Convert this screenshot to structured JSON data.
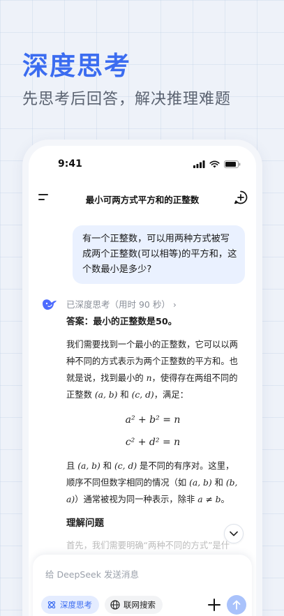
{
  "promo": {
    "headline": "深度思考",
    "subline": "先思考后回答，解决推理难题"
  },
  "status_bar": {
    "time": "9:41"
  },
  "nav": {
    "title": "最小可两方式平方和的正整数"
  },
  "user_message": "有一个正整数，可以用两种方式被写成两个正整数(可以相等)的平方和，这个数最小是多少?",
  "thinking": {
    "label": "已深度思考（用时 90 秒）",
    "chevron": "›"
  },
  "answer": {
    "heading": "答案：最小的正整数是50。",
    "p1": "我们需要找到一个最小的正整数，它可以以两种不同的方式表示为两个正整数的平方和。也就是说，找到最小的 ",
    "p1_n": "n",
    "p1_b": "，使得存在两组不同的正整数 ",
    "p1_ab": "(a, b)",
    "p1_and": " 和 ",
    "p1_cd": "(c, d)",
    "p1_end": "，满足：",
    "eq1": "a² + b² = n",
    "eq2": "c² + d² = n",
    "p2_a": "且 ",
    "p2_ab": "(a, b)",
    "p2_and": " 和 ",
    "p2_cd": "(c, d)",
    "p2_b": " 是不同的有序对。这里，顺序不同但数字相同的情况（如 ",
    "p2_ab2": "(a, b)",
    "p2_c": " 和 ",
    "p2_ba": "(b, a)",
    "p2_d": "）通常被视为同一种表示，除非 ",
    "p2_neq": "a ≠ b",
    "p2_e": "。",
    "section": "理解问题",
    "faded": "首先，我们需要明确“两种不同的方式”是什"
  },
  "composer": {
    "placeholder": "给 DeepSeek 发送消息",
    "deep_think_label": "深度思考",
    "web_search_label": "联网搜索"
  },
  "colors": {
    "accent": "#3b6cf0",
    "bubble": "#eaf1ff",
    "send": "#a9c2fb"
  }
}
